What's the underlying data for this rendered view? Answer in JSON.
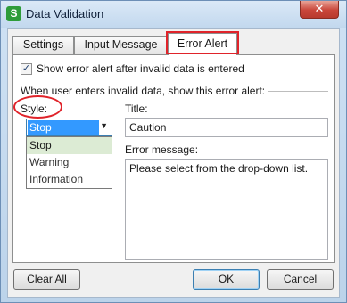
{
  "window": {
    "title": "Data Validation",
    "app_icon_letter": "S",
    "close_glyph": "✕"
  },
  "tabs": [
    "Settings",
    "Input Message",
    "Error Alert"
  ],
  "error_alert": {
    "show_alert_label": "Show error alert after invalid data is entered",
    "show_alert_checked": "✓",
    "section_label": "When user enters invalid data, show this error alert:",
    "style_label": "Style:",
    "style_selected": "Stop",
    "style_dropdown_arrow": "▼",
    "style_options": [
      "Stop",
      "Warning",
      "Information"
    ],
    "title_label": "Title:",
    "title_value": "Caution",
    "message_label": "Error message:",
    "message_value": "Please select from the drop-down list."
  },
  "buttons": {
    "clear_all": "Clear All",
    "ok": "OK",
    "cancel": "Cancel"
  },
  "colors": {
    "highlight": "#e0232a",
    "selection": "#3399ff",
    "hover": "#dcebd4"
  }
}
